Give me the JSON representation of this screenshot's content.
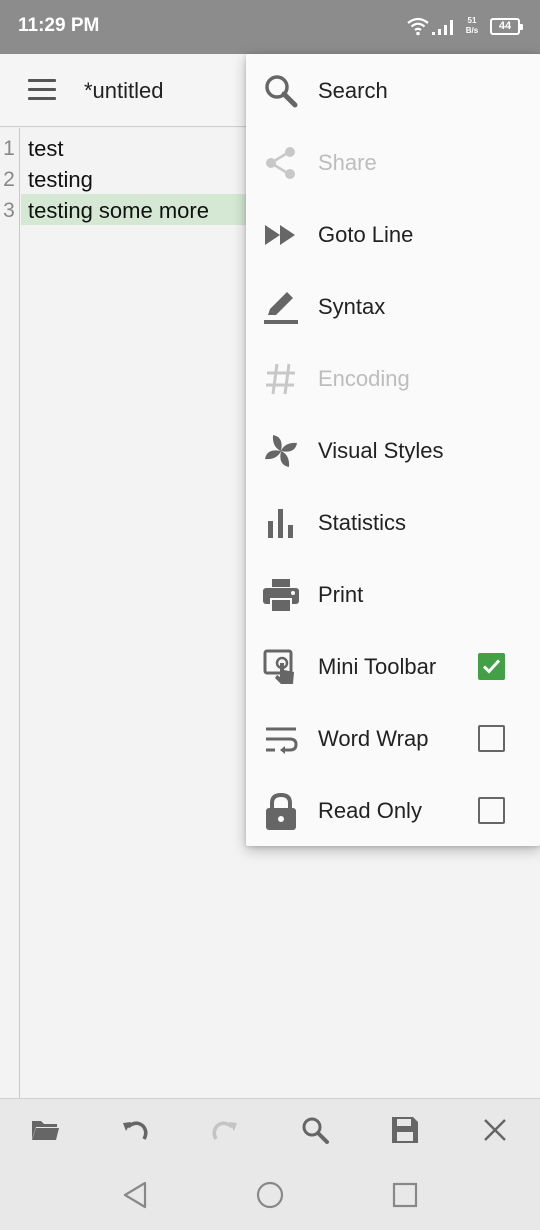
{
  "status_bar": {
    "time": "11:29 PM",
    "net_speed_value": "51",
    "net_speed_unit": "B/s",
    "battery": "44"
  },
  "app_bar": {
    "title": "*untitled",
    "menu_icon": "hamburger-icon"
  },
  "editor": {
    "lines": [
      {
        "number": "1",
        "text": "test"
      },
      {
        "number": "2",
        "text": "testing"
      },
      {
        "number": "3",
        "text": "testing some more"
      }
    ],
    "current_line": 3,
    "highlight_color": "#d4e8d4"
  },
  "overflow_menu": {
    "items": [
      {
        "label": "Search",
        "icon": "search-icon",
        "enabled": true
      },
      {
        "label": "Share",
        "icon": "share-icon",
        "enabled": false
      },
      {
        "label": "Goto Line",
        "icon": "fast-forward-icon",
        "enabled": true
      },
      {
        "label": "Syntax",
        "icon": "pen-underline-icon",
        "enabled": true
      },
      {
        "label": "Encoding",
        "icon": "hash-icon",
        "enabled": false
      },
      {
        "label": "Visual Styles",
        "icon": "pinwheel-icon",
        "enabled": true
      },
      {
        "label": "Statistics",
        "icon": "bar-chart-icon",
        "enabled": true
      },
      {
        "label": "Print",
        "icon": "printer-icon",
        "enabled": true
      },
      {
        "label": "Mini Toolbar",
        "icon": "touch-screen-icon",
        "enabled": true,
        "checked": true
      },
      {
        "label": "Word Wrap",
        "icon": "wrap-text-icon",
        "enabled": true,
        "checked": false
      },
      {
        "label": "Read Only",
        "icon": "lock-icon",
        "enabled": true,
        "checked": false
      }
    ],
    "check_color": "#43a047"
  },
  "bottom_toolbar": {
    "buttons": [
      "folder-open-icon",
      "undo-icon",
      "redo-icon",
      "search-icon",
      "save-icon",
      "close-icon"
    ]
  },
  "nav_bar": {
    "buttons": [
      "back-icon",
      "home-icon",
      "recents-icon"
    ]
  }
}
